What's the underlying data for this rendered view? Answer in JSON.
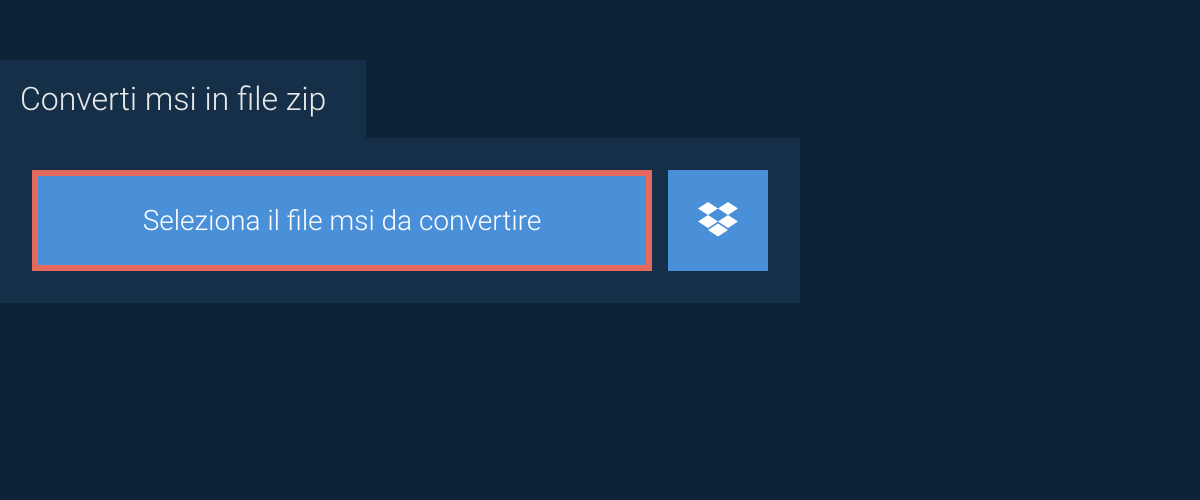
{
  "header": {
    "title": "Converti msi in file zip"
  },
  "actions": {
    "select_file_label": "Seleziona il file msi da convertire"
  },
  "colors": {
    "background": "#0d2438",
    "panel": "#142f47",
    "button": "#4a90d9",
    "highlight_border": "#e36a5c",
    "text_light": "#e8e8e8",
    "text_white": "#ffffff"
  }
}
